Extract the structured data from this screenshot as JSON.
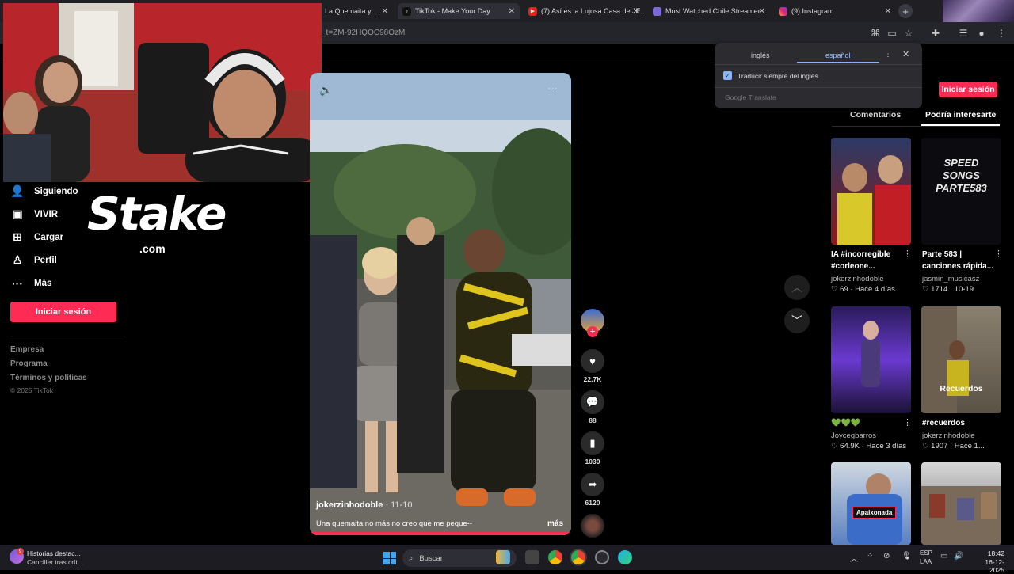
{
  "browser": {
    "tabs": [
      {
        "label": "La Quemaita y ...",
        "active": false
      },
      {
        "label": "TikTok - Make Your Day",
        "active": true
      },
      {
        "label": "(7) Así es la Lujosa Casa de JE...",
        "active": false
      },
      {
        "label": "Most Watched Chile Streamer...",
        "active": false
      },
      {
        "label": "(9) Instagram",
        "active": false
      }
    ],
    "url": "_t=ZM-92HQOC98OzM"
  },
  "translate_popup": {
    "source_lang": "inglés",
    "target_lang": "español",
    "always_translate": "Traducir siempre del inglés",
    "brand": "Google Translate"
  },
  "sidebar": {
    "items": [
      {
        "label": "Siguiendo",
        "icon": "following-icon"
      },
      {
        "label": "VIVIR",
        "icon": "live-icon"
      },
      {
        "label": "Cargar",
        "icon": "upload-icon"
      },
      {
        "label": "Perfil",
        "icon": "profile-icon"
      },
      {
        "label": "Más",
        "icon": "more-icon"
      }
    ],
    "login_button": "Iniciar sesión",
    "footer": [
      "Empresa",
      "Programa",
      "Términos y políticas"
    ],
    "copyright": "© 2025 TikTok"
  },
  "stake": {
    "word": "Stake",
    "domain": ".com"
  },
  "video": {
    "author": "jokerzinhodoble",
    "date": "· 11-10",
    "caption": "Una quemaita no más no creo que me peque--",
    "more": "más"
  },
  "actions": {
    "likes": "22.7K",
    "comments": "88",
    "saves": "1030",
    "shares": "6120"
  },
  "right_panel": {
    "login_button": "Iniciar sesión",
    "tabs": [
      "Comentarios",
      "Podría interesarte"
    ],
    "cards": [
      {
        "title_1": "IA #incorregible",
        "title_2": "#corleone...",
        "author": "jokerzinhodoble",
        "stats": "69 · Hace 4 días",
        "thumb_text": ""
      },
      {
        "title_1": "Parte 583 |",
        "title_2": "canciones rápida...",
        "author": "jasmin_musicasz",
        "stats": "1714 · 10-19",
        "thumb_text": "SPEED SONGS PARTE583"
      },
      {
        "title_1": "💚💚💚",
        "title_2": "",
        "author": "Joycegbarros",
        "stats": "64.9K · Hace 3 días",
        "thumb_text": ""
      },
      {
        "title_1": "#recuerdos",
        "title_2": "",
        "author": "jokerzinhodoble",
        "stats": "1907 · Hace 1...",
        "thumb_text": "Recuerdos"
      },
      {
        "title_1": "",
        "title_2": "",
        "author": "",
        "stats": "",
        "thumb_text": "Apaixonada"
      },
      {
        "title_1": "",
        "title_2": "",
        "author": "",
        "stats": "",
        "thumb_text": ""
      }
    ]
  },
  "taskbar": {
    "news_title": "Historias destac...",
    "news_sub": "Canciller tras crít...",
    "news_badge": "9",
    "search_placeholder": "Buscar",
    "lang_1": "ESP",
    "lang_2": "LAA",
    "time": "18:42",
    "date": "16-12-2025"
  },
  "colors": {
    "accent": "#fe2c55",
    "translate_blue": "#8ab4f8"
  }
}
